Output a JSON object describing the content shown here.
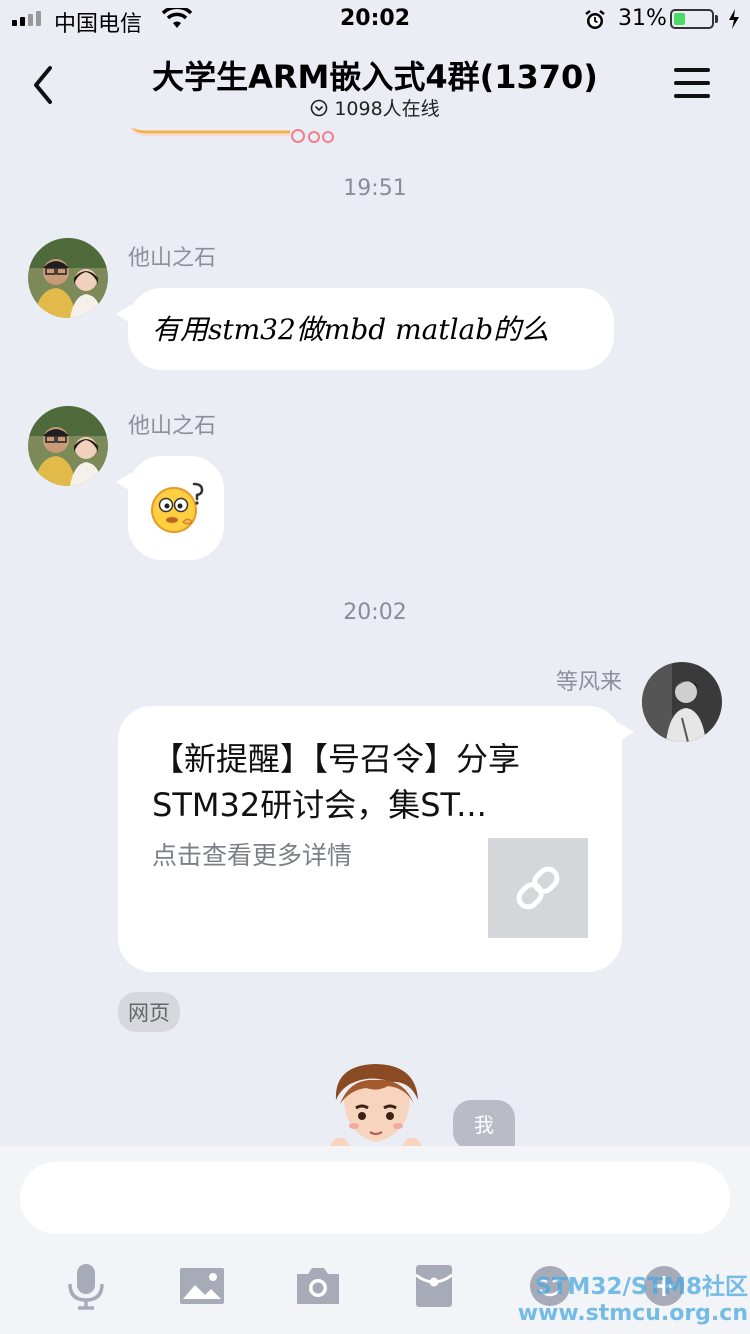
{
  "status_bar": {
    "carrier": "中国电信",
    "time": "20:02",
    "battery_percent": "31%",
    "battery_level": 0.31,
    "icons": [
      "signal-icon",
      "wifi-icon",
      "alarm-icon",
      "battery-icon",
      "charging-icon"
    ]
  },
  "header": {
    "title": "大学生ARM嵌入式4群(1370)",
    "online": "1098人在线",
    "icons": [
      "back-icon",
      "chevron-circle-icon",
      "menu-icon"
    ]
  },
  "messages": {
    "timestamp_1": "19:51",
    "timestamp_2": "20:02",
    "msg1": {
      "sender": "他山之石",
      "text": "有用stm32做mbd matlab的么"
    },
    "msg2": {
      "sender": "他山之石",
      "emoji": "confused-face-emoji"
    },
    "msg3": {
      "sender": "等风来",
      "card_title": "【新提醒】【号召令】分享STM32研讨会，集ST...",
      "card_desc": "点击查看更多详情",
      "card_icon": "link-icon",
      "source_tag": "网页"
    },
    "me_badge": "我"
  },
  "input": {
    "placeholder": ""
  },
  "toolbar": [
    "microphone-icon",
    "image-icon",
    "camera-icon",
    "red-packet-icon",
    "emoji-icon",
    "plus-icon"
  ],
  "watermark": {
    "line1": "STM32/STM8社区",
    "line2": "www.stmcu.org.cn"
  },
  "colors": {
    "background": "#ebedf5",
    "bubble": "#ffffff",
    "battery_fill": "#4cd964",
    "watermark": "#4aa8e0"
  }
}
